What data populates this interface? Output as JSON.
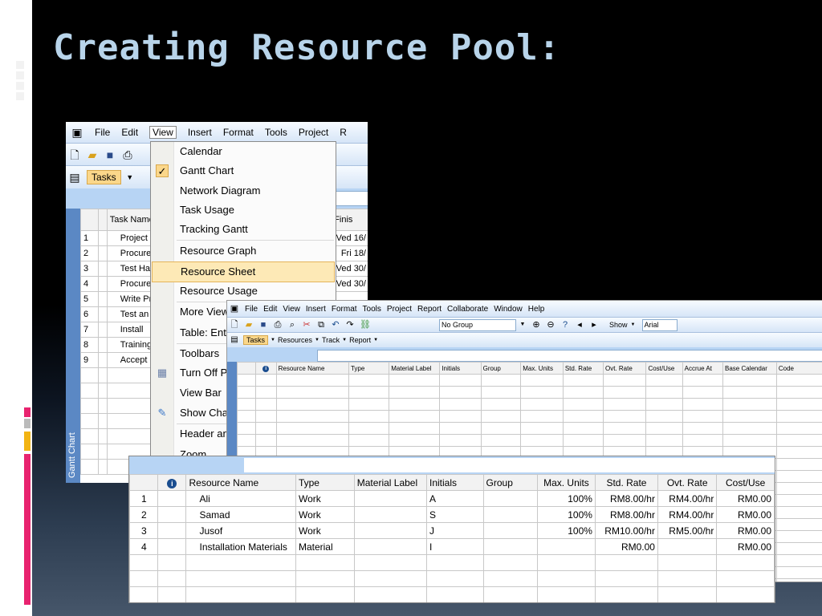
{
  "slide": {
    "title": "Creating Resource Pool:"
  },
  "menubar": [
    "File",
    "Edit",
    "View",
    "Insert",
    "Format",
    "Tools",
    "Project",
    "R"
  ],
  "toolbar1": {
    "tasks_label": "Tasks"
  },
  "gantt": {
    "side_label": "Gantt Chart",
    "col_task": "Task Name",
    "col_finish": "Finis",
    "rows": [
      {
        "id": "1",
        "name": "Project",
        "finish": "Ved 16/"
      },
      {
        "id": "2",
        "name": "Procure",
        "finish": "Fri 18/"
      },
      {
        "id": "3",
        "name": "Test Ha",
        "finish": "Ved 30/"
      },
      {
        "id": "4",
        "name": "Procure",
        "finish": "Ved 30/"
      },
      {
        "id": "5",
        "name": "Write Pr",
        "finish": ""
      },
      {
        "id": "6",
        "name": "Test an",
        "finish": ""
      },
      {
        "id": "7",
        "name": "Install",
        "finish": ""
      },
      {
        "id": "8",
        "name": "Training",
        "finish": ""
      },
      {
        "id": "9",
        "name": "Accept",
        "finish": ""
      }
    ]
  },
  "view_menu": {
    "items": [
      "Calendar",
      "Gantt Chart",
      "Network Diagram",
      "Task Usage",
      "Tracking Gantt",
      "Resource Graph",
      "Resource Sheet",
      "Resource Usage",
      "More Views",
      "Table: Ent",
      "Toolbars",
      "Turn Off P",
      "View Bar",
      "Show Cha",
      "Header an",
      "Zoom"
    ]
  },
  "sheet_window": {
    "menubar": [
      "File",
      "Edit",
      "View",
      "Insert",
      "Format",
      "Tools",
      "Project",
      "Report",
      "Collaborate",
      "Window",
      "Help"
    ],
    "group_value": "No Group",
    "show_label": "Show",
    "font_value": "Arial",
    "view_tabs": [
      "Tasks",
      "Resources",
      "Track",
      "Report"
    ],
    "columns": [
      "Resource Name",
      "Type",
      "Material Label",
      "Initials",
      "Group",
      "Max. Units",
      "Std. Rate",
      "Ovt. Rate",
      "Cost/Use",
      "Accrue At",
      "Base Calendar",
      "Code"
    ]
  },
  "resource_table": {
    "columns": [
      "Resource Name",
      "Type",
      "Material Label",
      "Initials",
      "Group",
      "Max. Units",
      "Std. Rate",
      "Ovt. Rate",
      "Cost/Use"
    ],
    "rows": [
      {
        "id": "1",
        "name": "Ali",
        "type": "Work",
        "material": "",
        "initials": "A",
        "group": "",
        "max": "100%",
        "std": "RM8.00/hr",
        "ovt": "RM4.00/hr",
        "cost": "RM0.00"
      },
      {
        "id": "2",
        "name": "Samad",
        "type": "Work",
        "material": "",
        "initials": "S",
        "group": "",
        "max": "100%",
        "std": "RM8.00/hr",
        "ovt": "RM4.00/hr",
        "cost": "RM0.00"
      },
      {
        "id": "3",
        "name": "Jusof",
        "type": "Work",
        "material": "",
        "initials": "J",
        "group": "",
        "max": "100%",
        "std": "RM10.00/hr",
        "ovt": "RM5.00/hr",
        "cost": "RM0.00"
      },
      {
        "id": "4",
        "name": "Installation Materials",
        "type": "Material",
        "material": "",
        "initials": "I",
        "group": "",
        "max": "",
        "std": "RM0.00",
        "ovt": "",
        "cost": "RM0.00"
      }
    ]
  }
}
